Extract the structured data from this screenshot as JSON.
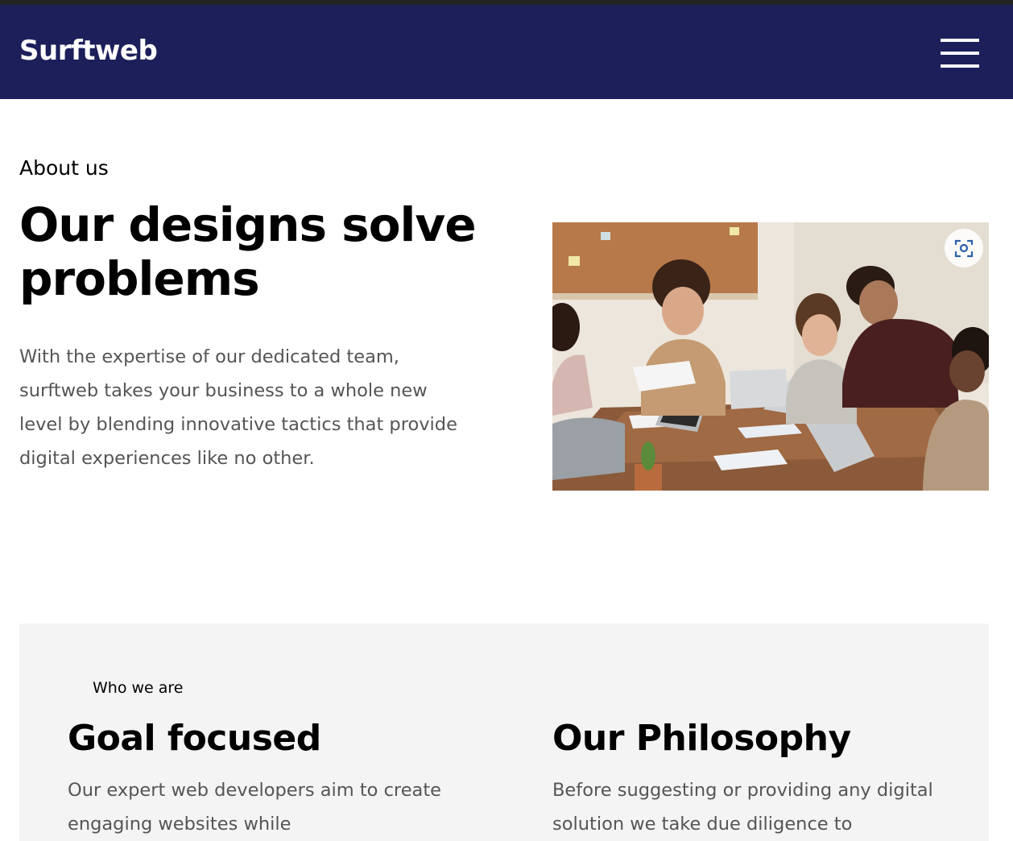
{
  "header": {
    "logo": "Surftweb",
    "menu_icon": "hamburger-menu-icon",
    "background": "#1c1f5a"
  },
  "hero": {
    "eyebrow": "About us",
    "title": "Our designs solve problems",
    "text": "With the expertise of our dedicated team, surftweb takes your business to a whole new level by blending innovative tactics that provide digital experiences like no other.",
    "image_icon": "visual-search-lens-icon"
  },
  "who": {
    "eyebrow": "Who we are",
    "columns": [
      {
        "title": "Goal focused",
        "text": "Our expert web developers aim to create engaging websites while"
      },
      {
        "title": "Our Philosophy",
        "text": "Before suggesting or providing any digital solution we take due diligence to"
      }
    ]
  },
  "colors": {
    "body_text": "#555555",
    "card_background": "#f4f4f4"
  }
}
